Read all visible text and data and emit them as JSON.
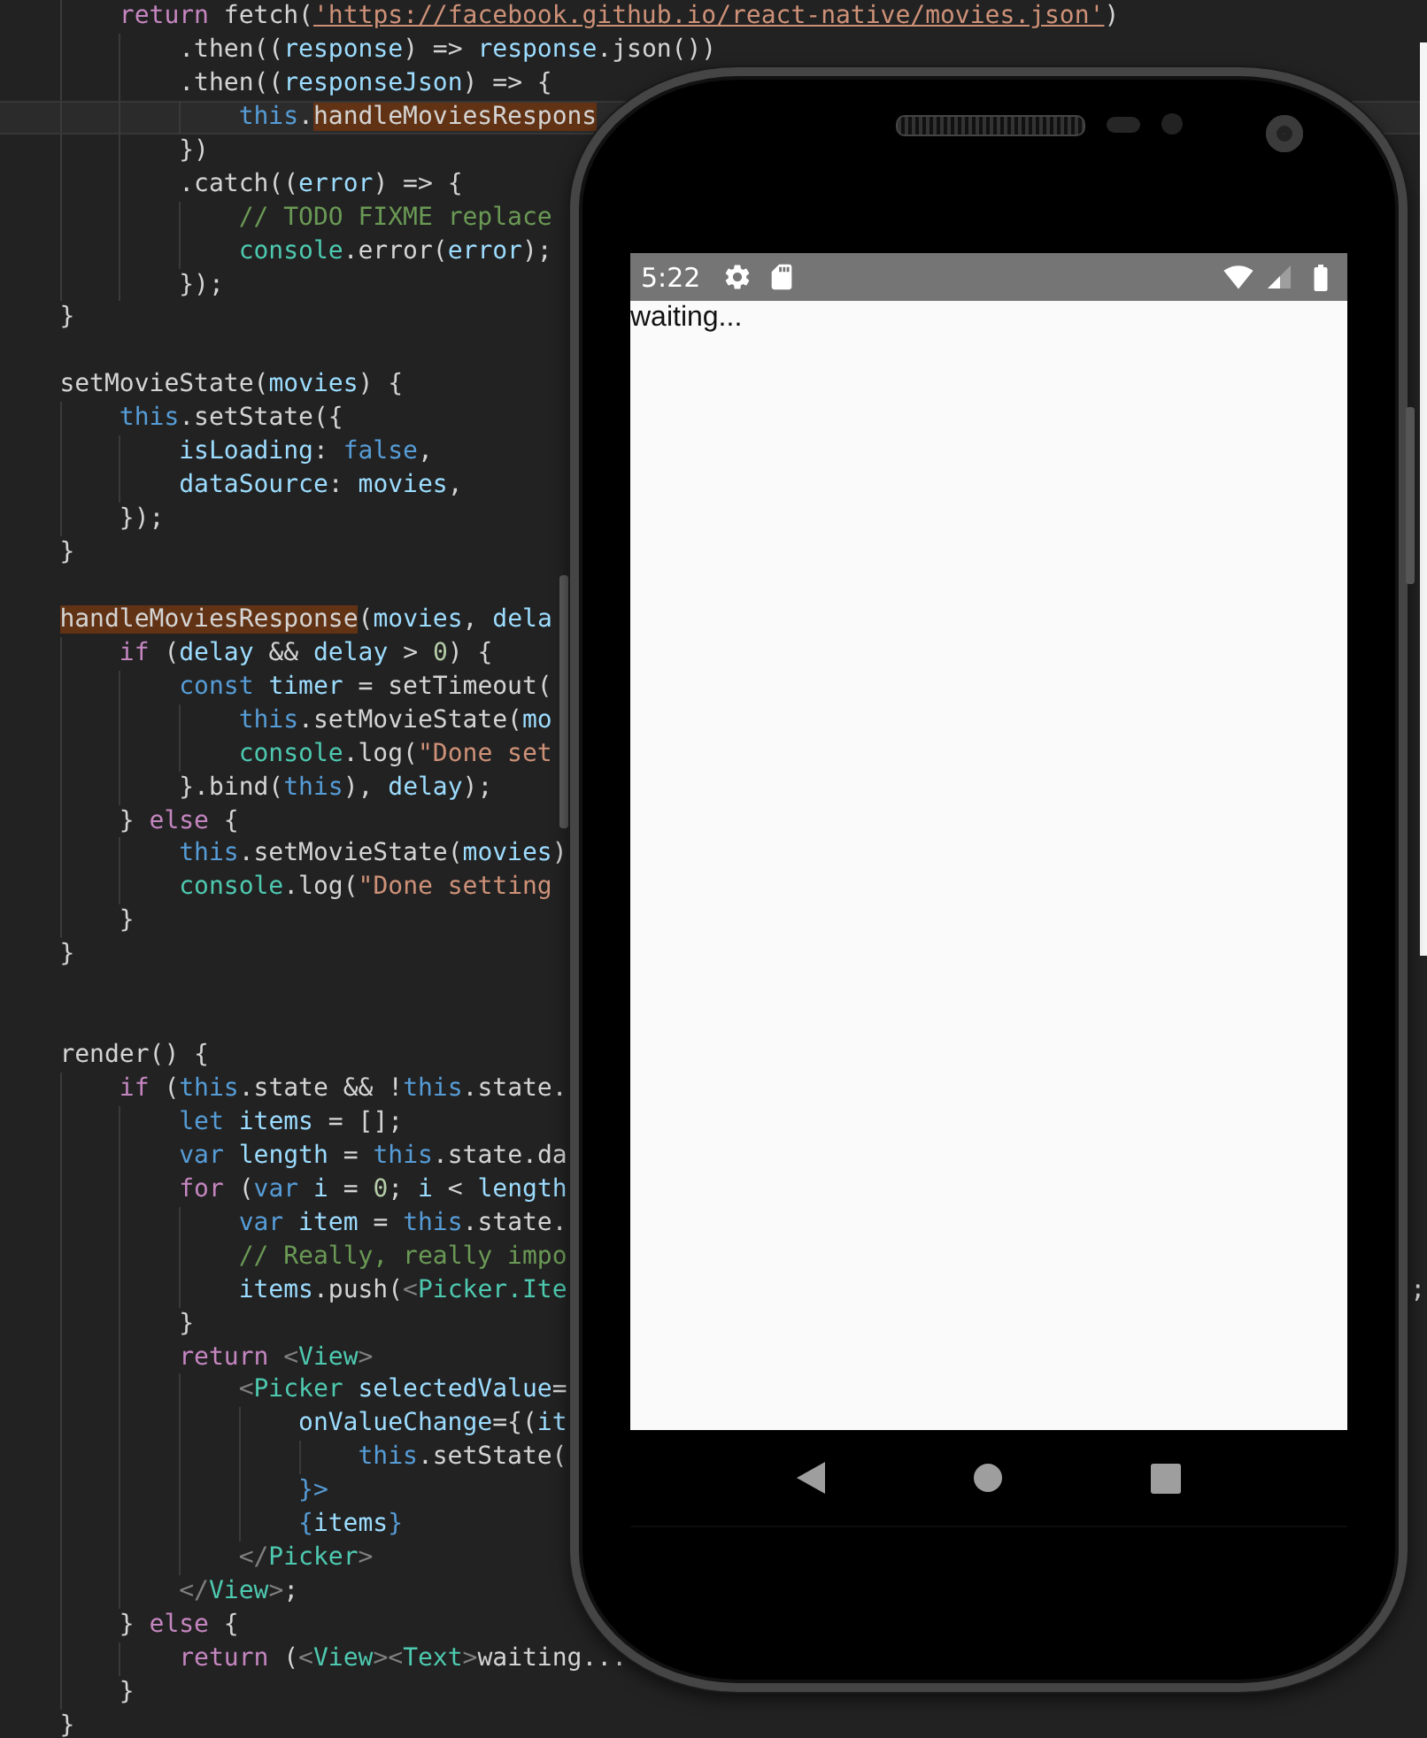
{
  "editor": {
    "lines": [
      {
        "kind": "code",
        "current": false,
        "tokens": [
          {
            "kind": "keyword",
            "text": "        return"
          },
          {
            "kind": "plain",
            "text": " fetch("
          },
          {
            "kind": "link",
            "text": "'https://facebook.github.io/react-native/movies.json'"
          },
          {
            "kind": "plain",
            "text": ")"
          }
        ]
      },
      {
        "kind": "code",
        "current": false,
        "tokens": [
          {
            "kind": "plain",
            "text": "            .then(("
          },
          {
            "kind": "variable",
            "text": "response"
          },
          {
            "kind": "plain",
            "text": ") => "
          },
          {
            "kind": "variable",
            "text": "response"
          },
          {
            "kind": "plain",
            "text": ".json())"
          }
        ]
      },
      {
        "kind": "code",
        "current": false,
        "tokens": [
          {
            "kind": "plain",
            "text": "            .then(("
          },
          {
            "kind": "variable",
            "text": "responseJson"
          },
          {
            "kind": "plain",
            "text": ") => {"
          }
        ]
      },
      {
        "kind": "code",
        "current": true,
        "tokens": [
          {
            "kind": "builtin",
            "text": "                this"
          },
          {
            "kind": "plain",
            "text": "."
          },
          {
            "kind": "match",
            "text": "handleMoviesRespons"
          }
        ]
      },
      {
        "kind": "code",
        "current": false,
        "tokens": [
          {
            "kind": "plain",
            "text": "            })"
          }
        ]
      },
      {
        "kind": "code",
        "current": false,
        "tokens": [
          {
            "kind": "plain",
            "text": "            .catch(("
          },
          {
            "kind": "variable",
            "text": "error"
          },
          {
            "kind": "plain",
            "text": ") => {"
          }
        ]
      },
      {
        "kind": "code",
        "current": false,
        "tokens": [
          {
            "kind": "comment",
            "text": "                // TODO FIXME replace"
          }
        ]
      },
      {
        "kind": "code",
        "current": false,
        "tokens": [
          {
            "kind": "class",
            "text": "                console"
          },
          {
            "kind": "plain",
            "text": ".error("
          },
          {
            "kind": "variable",
            "text": "error"
          },
          {
            "kind": "plain",
            "text": ");"
          }
        ]
      },
      {
        "kind": "code",
        "current": false,
        "tokens": [
          {
            "kind": "plain",
            "text": "            });"
          }
        ]
      },
      {
        "kind": "code",
        "current": false,
        "tokens": [
          {
            "kind": "plain",
            "text": "    }"
          }
        ]
      },
      {
        "kind": "blank",
        "current": false
      },
      {
        "kind": "code",
        "current": false,
        "tokens": [
          {
            "kind": "plain",
            "text": "    setMovieState("
          },
          {
            "kind": "variable",
            "text": "movies"
          },
          {
            "kind": "plain",
            "text": ") {"
          }
        ]
      },
      {
        "kind": "code",
        "current": false,
        "tokens": [
          {
            "kind": "builtin",
            "text": "        this"
          },
          {
            "kind": "plain",
            "text": ".setState({"
          }
        ]
      },
      {
        "kind": "code",
        "current": false,
        "tokens": [
          {
            "kind": "variable",
            "text": "            isLoading"
          },
          {
            "kind": "plain",
            "text": ": "
          },
          {
            "kind": "builtin",
            "text": "false"
          },
          {
            "kind": "plain",
            "text": ","
          }
        ]
      },
      {
        "kind": "code",
        "current": false,
        "tokens": [
          {
            "kind": "variable",
            "text": "            dataSource"
          },
          {
            "kind": "plain",
            "text": ": "
          },
          {
            "kind": "variable",
            "text": "movies"
          },
          {
            "kind": "plain",
            "text": ","
          }
        ]
      },
      {
        "kind": "code",
        "current": false,
        "tokens": [
          {
            "kind": "plain",
            "text": "        });"
          }
        ]
      },
      {
        "kind": "code",
        "current": false,
        "tokens": [
          {
            "kind": "plain",
            "text": "    }"
          }
        ]
      },
      {
        "kind": "blank",
        "current": false
      },
      {
        "kind": "code",
        "current": false,
        "tokens": [
          {
            "kind": "match",
            "text": "    handleMoviesResponse"
          },
          {
            "kind": "plain",
            "text": "("
          },
          {
            "kind": "variable",
            "text": "movies"
          },
          {
            "kind": "plain",
            "text": ", "
          },
          {
            "kind": "variable",
            "text": "dela"
          }
        ]
      },
      {
        "kind": "code",
        "current": false,
        "tokens": [
          {
            "kind": "keyword",
            "text": "        if"
          },
          {
            "kind": "plain",
            "text": " ("
          },
          {
            "kind": "variable",
            "text": "delay"
          },
          {
            "kind": "plain",
            "text": " && "
          },
          {
            "kind": "variable",
            "text": "delay"
          },
          {
            "kind": "plain",
            "text": " > "
          },
          {
            "kind": "number",
            "text": "0"
          },
          {
            "kind": "plain",
            "text": ") {"
          }
        ]
      },
      {
        "kind": "code",
        "current": false,
        "tokens": [
          {
            "kind": "builtin",
            "text": "            const"
          },
          {
            "kind": "variable",
            "text": " timer"
          },
          {
            "kind": "plain",
            "text": " = setTimeout("
          }
        ]
      },
      {
        "kind": "code",
        "current": false,
        "tokens": [
          {
            "kind": "builtin",
            "text": "                this"
          },
          {
            "kind": "plain",
            "text": ".setMovieState("
          },
          {
            "kind": "variable",
            "text": "mo"
          }
        ]
      },
      {
        "kind": "code",
        "current": false,
        "tokens": [
          {
            "kind": "class",
            "text": "                console"
          },
          {
            "kind": "plain",
            "text": ".log("
          },
          {
            "kind": "string",
            "text": "\"Done set"
          }
        ]
      },
      {
        "kind": "code",
        "current": false,
        "tokens": [
          {
            "kind": "plain",
            "text": "            }.bind("
          },
          {
            "kind": "builtin",
            "text": "this"
          },
          {
            "kind": "plain",
            "text": "), "
          },
          {
            "kind": "variable",
            "text": "delay"
          },
          {
            "kind": "plain",
            "text": ");"
          }
        ]
      },
      {
        "kind": "code",
        "current": false,
        "tokens": [
          {
            "kind": "plain",
            "text": "        } "
          },
          {
            "kind": "keyword",
            "text": "else"
          },
          {
            "kind": "plain",
            "text": " {"
          }
        ]
      },
      {
        "kind": "code",
        "current": false,
        "tokens": [
          {
            "kind": "builtin",
            "text": "            this"
          },
          {
            "kind": "plain",
            "text": ".setMovieState("
          },
          {
            "kind": "variable",
            "text": "movies"
          },
          {
            "kind": "plain",
            "text": ")"
          }
        ]
      },
      {
        "kind": "code",
        "current": false,
        "tokens": [
          {
            "kind": "class",
            "text": "            console"
          },
          {
            "kind": "plain",
            "text": ".log("
          },
          {
            "kind": "string",
            "text": "\"Done setting"
          }
        ]
      },
      {
        "kind": "code",
        "current": false,
        "tokens": [
          {
            "kind": "plain",
            "text": "        }"
          }
        ]
      },
      {
        "kind": "code",
        "current": false,
        "tokens": [
          {
            "kind": "plain",
            "text": "    }"
          }
        ]
      },
      {
        "kind": "blank",
        "current": false
      },
      {
        "kind": "blank",
        "current": false
      },
      {
        "kind": "code",
        "current": false,
        "tokens": [
          {
            "kind": "plain",
            "text": "    render() {"
          }
        ]
      },
      {
        "kind": "code",
        "current": false,
        "tokens": [
          {
            "kind": "keyword",
            "text": "        if"
          },
          {
            "kind": "plain",
            "text": " ("
          },
          {
            "kind": "builtin",
            "text": "this"
          },
          {
            "kind": "plain",
            "text": ".state && !"
          },
          {
            "kind": "builtin",
            "text": "this"
          },
          {
            "kind": "plain",
            "text": ".state."
          }
        ]
      },
      {
        "kind": "code",
        "current": false,
        "tokens": [
          {
            "kind": "builtin",
            "text": "            let"
          },
          {
            "kind": "variable",
            "text": " items"
          },
          {
            "kind": "plain",
            "text": " = [];"
          }
        ]
      },
      {
        "kind": "code",
        "current": false,
        "tokens": [
          {
            "kind": "builtin",
            "text": "            var"
          },
          {
            "kind": "variable",
            "text": " length"
          },
          {
            "kind": "plain",
            "text": " = "
          },
          {
            "kind": "builtin",
            "text": "this"
          },
          {
            "kind": "plain",
            "text": ".state.da"
          }
        ]
      },
      {
        "kind": "code",
        "current": false,
        "tokens": [
          {
            "kind": "keyword",
            "text": "            for"
          },
          {
            "kind": "plain",
            "text": " ("
          },
          {
            "kind": "builtin",
            "text": "var"
          },
          {
            "kind": "variable",
            "text": " i"
          },
          {
            "kind": "plain",
            "text": " = "
          },
          {
            "kind": "number",
            "text": "0"
          },
          {
            "kind": "plain",
            "text": "; "
          },
          {
            "kind": "variable",
            "text": "i"
          },
          {
            "kind": "plain",
            "text": " < "
          },
          {
            "kind": "variable",
            "text": "length"
          }
        ]
      },
      {
        "kind": "code",
        "current": false,
        "tokens": [
          {
            "kind": "builtin",
            "text": "                var"
          },
          {
            "kind": "variable",
            "text": " item"
          },
          {
            "kind": "plain",
            "text": " = "
          },
          {
            "kind": "builtin",
            "text": "this"
          },
          {
            "kind": "plain",
            "text": ".state."
          }
        ]
      },
      {
        "kind": "code",
        "current": false,
        "tokens": [
          {
            "kind": "comment",
            "text": "                // Really, really impo"
          }
        ]
      },
      {
        "kind": "code",
        "current": false,
        "tokens": [
          {
            "kind": "variable",
            "text": "                items"
          },
          {
            "kind": "plain",
            "text": ".push("
          },
          {
            "kind": "bracket",
            "text": "<"
          },
          {
            "kind": "class",
            "text": "Picker.Ite"
          }
        ],
        "tail": ";"
      },
      {
        "kind": "code",
        "current": false,
        "tokens": [
          {
            "kind": "plain",
            "text": "            }"
          }
        ]
      },
      {
        "kind": "code",
        "current": false,
        "tokens": [
          {
            "kind": "keyword",
            "text": "            return"
          },
          {
            "kind": "bracket",
            "text": " <"
          },
          {
            "kind": "class",
            "text": "View"
          },
          {
            "kind": "bracket",
            "text": ">"
          }
        ]
      },
      {
        "kind": "code",
        "current": false,
        "tokens": [
          {
            "kind": "bracket",
            "text": "                <"
          },
          {
            "kind": "class",
            "text": "Picker"
          },
          {
            "kind": "variable",
            "text": " selectedValue"
          },
          {
            "kind": "plain",
            "text": "="
          }
        ]
      },
      {
        "kind": "code",
        "current": false,
        "tokens": [
          {
            "kind": "variable",
            "text": "                    onValueChange"
          },
          {
            "kind": "plain",
            "text": "={("
          },
          {
            "kind": "variable",
            "text": "it"
          }
        ]
      },
      {
        "kind": "code",
        "current": false,
        "tokens": [
          {
            "kind": "builtin",
            "text": "                        this"
          },
          {
            "kind": "plain",
            "text": ".setState("
          }
        ]
      },
      {
        "kind": "code",
        "current": false,
        "tokens": [
          {
            "kind": "builtin",
            "text": "                    }>"
          }
        ]
      },
      {
        "kind": "code",
        "current": false,
        "tokens": [
          {
            "kind": "builtin",
            "text": "                    {"
          },
          {
            "kind": "variable",
            "text": "items"
          },
          {
            "kind": "builtin",
            "text": "}"
          }
        ]
      },
      {
        "kind": "code",
        "current": false,
        "tokens": [
          {
            "kind": "bracket",
            "text": "                </"
          },
          {
            "kind": "class",
            "text": "Picker"
          },
          {
            "kind": "bracket",
            "text": ">"
          }
        ]
      },
      {
        "kind": "code",
        "current": false,
        "tokens": [
          {
            "kind": "bracket",
            "text": "            </"
          },
          {
            "kind": "class",
            "text": "View"
          },
          {
            "kind": "bracket",
            "text": ">"
          },
          {
            "kind": "plain",
            "text": ";"
          }
        ]
      },
      {
        "kind": "code",
        "current": false,
        "tokens": [
          {
            "kind": "plain",
            "text": "        } "
          },
          {
            "kind": "keyword",
            "text": "else"
          },
          {
            "kind": "plain",
            "text": " {"
          }
        ]
      },
      {
        "kind": "code",
        "current": false,
        "tokens": [
          {
            "kind": "keyword",
            "text": "            return"
          },
          {
            "kind": "plain",
            "text": " ("
          },
          {
            "kind": "bracket",
            "text": "<"
          },
          {
            "kind": "class",
            "text": "View"
          },
          {
            "kind": "bracket",
            "text": "><"
          },
          {
            "kind": "class",
            "text": "Text"
          },
          {
            "kind": "bracket",
            "text": ">"
          },
          {
            "kind": "plain",
            "text": "waiting..."
          }
        ]
      },
      {
        "kind": "code",
        "current": false,
        "tokens": [
          {
            "kind": "plain",
            "text": "        }"
          }
        ]
      },
      {
        "kind": "code",
        "current": false,
        "tokens": [
          {
            "kind": "plain",
            "text": "    }"
          }
        ]
      }
    ]
  },
  "emulator": {
    "status_bar": {
      "time": "5:22"
    },
    "app_text": "waiting..."
  }
}
